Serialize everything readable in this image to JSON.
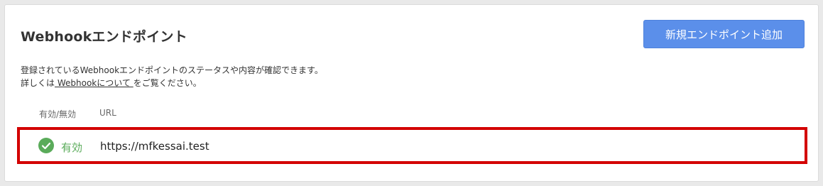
{
  "header": {
    "title": "Webhookエンドポイント",
    "add_button_label": "新規エンドポイント追加"
  },
  "description": {
    "line1": "登録されているWebhookエンドポイントのステータスや内容が確認できます。",
    "line2_prefix": "詳しくは",
    "link_label": " Webhookについて ",
    "line2_suffix": "をご覧ください。"
  },
  "table": {
    "columns": {
      "status": "有効/無効",
      "url": "URL"
    },
    "rows": [
      {
        "status": "有効",
        "status_icon": "check-circle-icon",
        "url": "https://mfkessai.test"
      }
    ]
  },
  "colors": {
    "accent": "#5b8fea",
    "active_status": "#5aab5a",
    "highlight_border": "#d30000"
  }
}
